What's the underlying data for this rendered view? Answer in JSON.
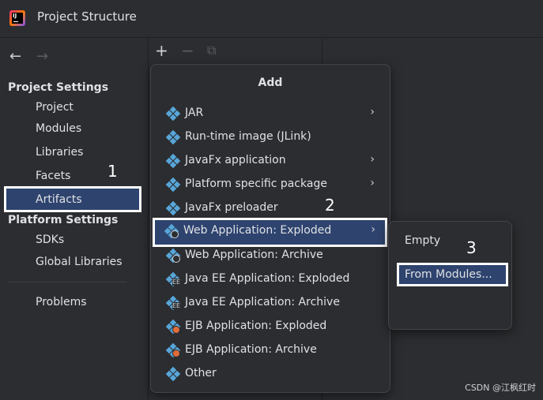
{
  "window": {
    "title": "Project Structure"
  },
  "nav": {
    "back_icon": "←",
    "forward_icon": "→"
  },
  "sidebar": {
    "project_settings_header": "Project Settings",
    "project_items": [
      "Project",
      "Modules",
      "Libraries",
      "Facets",
      "Artifacts"
    ],
    "platform_settings_header": "Platform Settings",
    "platform_items": [
      "SDKs",
      "Global Libraries"
    ],
    "problems": "Problems"
  },
  "toolbar": {
    "add_icon": "+",
    "remove_icon": "−",
    "copy_icon": "⧉"
  },
  "add_popup": {
    "title": "Add",
    "items": [
      {
        "label": "JAR",
        "submenu": true,
        "icon": "artifact-icon"
      },
      {
        "label": "Run-time image (JLink)",
        "submenu": false,
        "icon": "artifact-icon"
      },
      {
        "label": "JavaFx application",
        "submenu": true,
        "icon": "artifact-icon"
      },
      {
        "label": "Platform specific package",
        "submenu": true,
        "icon": "artifact-icon"
      },
      {
        "label": "JavaFx preloader",
        "submenu": false,
        "icon": "artifact-icon"
      },
      {
        "label": "Web Application: Exploded",
        "submenu": true,
        "icon": "web-artifact-icon"
      },
      {
        "label": "Web Application: Archive",
        "submenu": false,
        "icon": "web-artifact-icon"
      },
      {
        "label": "Java EE Application: Exploded",
        "submenu": false,
        "icon": "javaee-artifact-icon"
      },
      {
        "label": "Java EE Application: Archive",
        "submenu": false,
        "icon": "javaee-artifact-icon"
      },
      {
        "label": "EJB Application: Exploded",
        "submenu": false,
        "icon": "ejb-artifact-icon"
      },
      {
        "label": "EJB Application: Archive",
        "submenu": false,
        "icon": "ejb-artifact-icon"
      },
      {
        "label": "Other",
        "submenu": false,
        "icon": "artifact-icon"
      }
    ],
    "chevron": "›"
  },
  "submenu": {
    "empty_label": "Empty",
    "from_modules_label": "From Modules..."
  },
  "annotations": {
    "step1": "1",
    "step2": "2",
    "step3": "3"
  },
  "watermark": "CSDN @江枫红时",
  "colors": {
    "selection": "#2e436e",
    "highlight_border": "#ffffff",
    "background": "#2b2d30",
    "icon_blue": "#58a6d9"
  }
}
